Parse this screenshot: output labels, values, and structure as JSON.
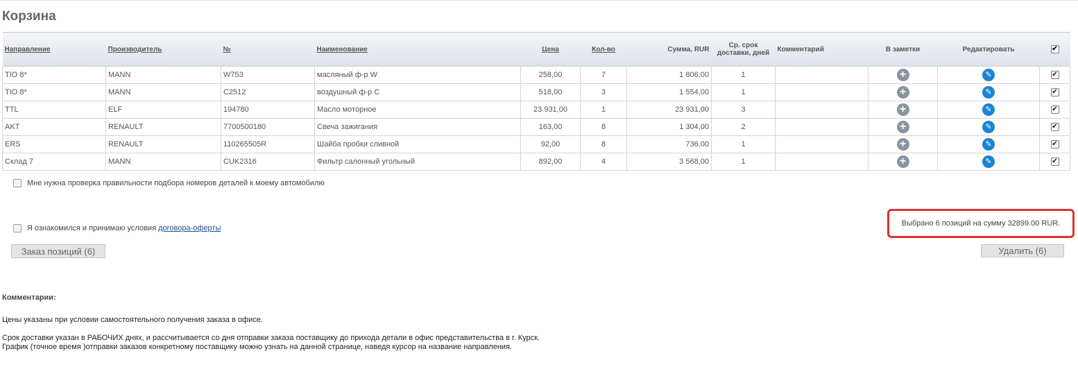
{
  "page": {
    "title": "Корзина"
  },
  "table": {
    "headers": {
      "direction": "Направление",
      "manufacturer": "Производитель",
      "number": "№",
      "name": "Наименование",
      "price": "Цена",
      "qty": "Кол-во",
      "sum": "Сумма, RUR",
      "delivery": "Ср. срок доставки, дней",
      "comment": "Комментарий",
      "notes": "В заметки",
      "edit": "Редактировать"
    },
    "rows": [
      {
        "direction": "TIO 8*",
        "manufacturer": "MANN",
        "number": "W753",
        "name": "масляный ф-р W",
        "price": "258,00",
        "qty": "7",
        "sum": "1 806,00",
        "delivery": "1",
        "comment": ""
      },
      {
        "direction": "TIO 8*",
        "manufacturer": "MANN",
        "number": "C2512",
        "name": "воздушный ф-р C",
        "price": "518,00",
        "qty": "3",
        "sum": "1 554,00",
        "delivery": "1",
        "comment": ""
      },
      {
        "direction": "TTL",
        "manufacturer": "ELF",
        "number": "194780",
        "name": "Масло моторное",
        "price": "23 931,00",
        "qty": "1",
        "sum": "23 931,00",
        "delivery": "3",
        "comment": ""
      },
      {
        "direction": "AKT",
        "manufacturer": "RENAULT",
        "number": "7700500180",
        "name": "Свеча зажигания",
        "price": "163,00",
        "qty": "8",
        "sum": "1 304,00",
        "delivery": "2",
        "comment": ""
      },
      {
        "direction": "ERS",
        "manufacturer": "RENAULT",
        "number": "110265505R",
        "name": "Шайба пробки сливной",
        "price": "92,00",
        "qty": "8",
        "sum": "736,00",
        "delivery": "1",
        "comment": ""
      },
      {
        "direction": "Склад 7",
        "manufacturer": "MANN",
        "number": "CUK2316",
        "name": "Фильтр салонный угольный",
        "price": "892,00",
        "qty": "4",
        "sum": "3 568,00",
        "delivery": "1",
        "comment": ""
      }
    ]
  },
  "options": {
    "check_numbers": "Мне нужна проверка правильности подбора номеров деталей к моему автомобилю",
    "agree_prefix": "Я ознакомился и принимаю условия ",
    "agree_link": "договора-оферты"
  },
  "buttons": {
    "order": "Заказ позиций (6)",
    "delete": "Удалить (6)"
  },
  "summary": "Выбрано 6 позиций на сумму 32899.00 RUR.",
  "comments": {
    "title": "Комментарии:",
    "p1": "Цены указаны при условии самостоятельного получения заказа в офисе.",
    "p2": "Срок доставки указан в РАБОЧИХ днях, и рассчитывается со дня отправки заказа поставщику до прихода детали в офис представительства в г. Курск. График (точное время )отправки заказов конкретному поставщику можно узнать на данной странице, наведя курсор на название направления."
  },
  "icons": {
    "add_to_notes": "plus-circle-icon",
    "edit": "pencil-icon",
    "checkbox": "checkbox-icon"
  }
}
